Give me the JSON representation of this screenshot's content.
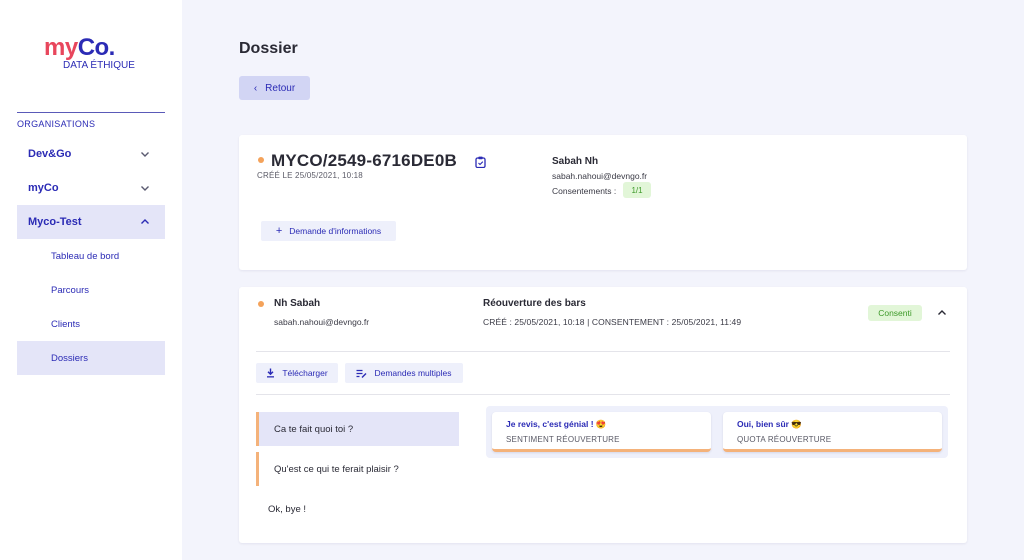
{
  "brand": {
    "name_part1": "my",
    "name_part2": "Co.",
    "tagline": "DATA ÉTHIQUE"
  },
  "sidebar": {
    "section_title": "ORGANISATIONS",
    "orgs": [
      {
        "label": "Dev&Go",
        "expanded": false
      },
      {
        "label": "myCo",
        "expanded": false
      },
      {
        "label": "Myco-Test",
        "expanded": true
      }
    ],
    "sub_items": [
      {
        "label": "Tableau de bord",
        "active": false
      },
      {
        "label": "Parcours",
        "active": false
      },
      {
        "label": "Clients",
        "active": false
      },
      {
        "label": "Dossiers",
        "active": true
      }
    ]
  },
  "header": {
    "title": "Dossier",
    "back_label": "Retour"
  },
  "dossier": {
    "id": "MYCO/2549-6716DE0B",
    "created": "CRÉÉ LE 25/05/2021, 10:18",
    "person_name": "Sabah Nh",
    "person_email": "sabah.nahoui@devngo.fr",
    "consents_label": "Consentements :",
    "consents_value": "1/1",
    "info_request_label": "Demande d'informations"
  },
  "parcours": {
    "client_name": "Nh Sabah",
    "client_email": "sabah.nahoui@devngo.fr",
    "title": "Réouverture des bars",
    "meta": "CRÉÉ : 25/05/2021, 10:18 | CONSENTEMENT : 25/05/2021, 11:49",
    "status": "Consenti",
    "download_label": "Télécharger",
    "multi_label": "Demandes multiples",
    "questions": [
      "Ca te fait quoi toi ?",
      "Qu'est ce qui te ferait plaisir ?",
      "Ok, bye !"
    ],
    "answers": [
      {
        "text": "Je revis, c'est génial ! 😍",
        "label": "SENTIMENT RÉOUVERTURE"
      },
      {
        "text": "Oui, bien sûr 😎",
        "label": "QUOTA RÉOUVERTURE"
      }
    ]
  },
  "colors": {
    "accent": "#2b2bb5",
    "brand_red": "#e8465c",
    "status_dot": "#f4a25a",
    "success": "#3e9a2a"
  }
}
